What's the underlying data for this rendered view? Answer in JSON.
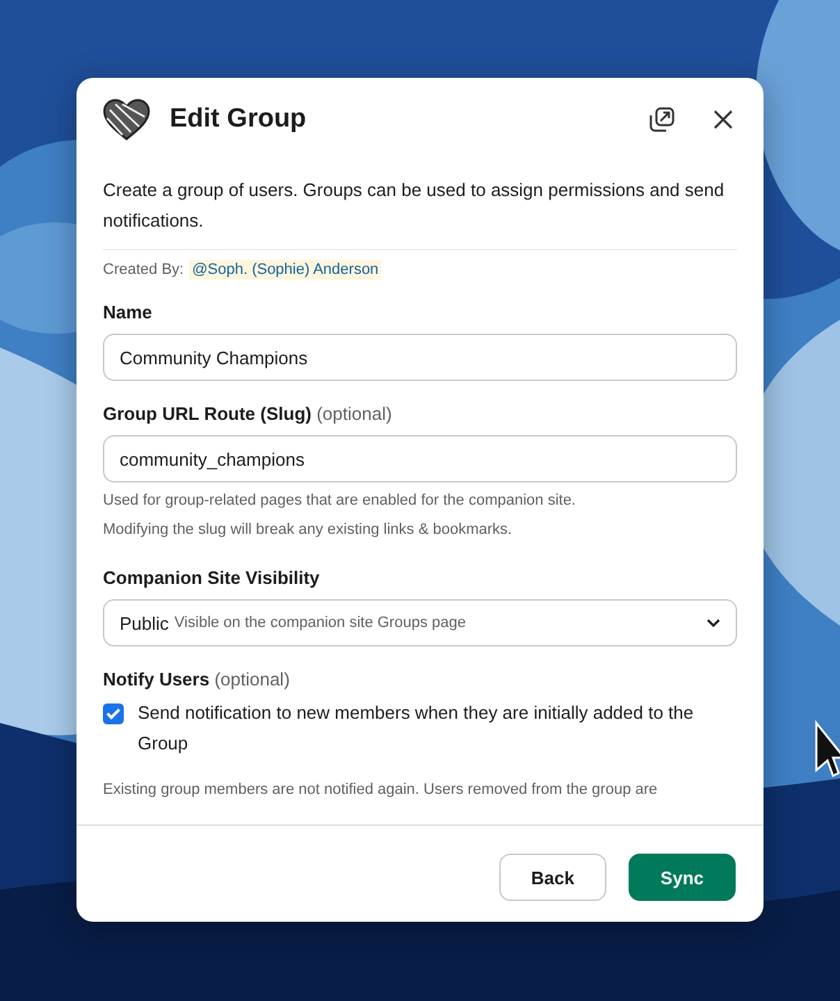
{
  "dialog": {
    "title": "Edit Group",
    "description": "Create a group of users. Groups can be used to assign permissions and send notifications.",
    "created_by": {
      "label": "Created By:",
      "user": "@Soph. (Sophie) Anderson"
    },
    "fields": [
      {
        "kind": "text",
        "label": "Name",
        "value": "Community Champions"
      },
      {
        "kind": "text",
        "label": "Group URL Route (Slug)",
        "note": "(optional)",
        "value": "community_champions",
        "help": [
          "Used for group-related pages that are enabled for the companion site.",
          "Modifying the slug will break any existing links & bookmarks."
        ]
      },
      {
        "kind": "select",
        "label": "Companion Site Visibility",
        "value": "Public",
        "detail": "Visible on the companion site Groups page"
      },
      {
        "kind": "checkbox",
        "label": "Notify Users",
        "note": "(optional)",
        "option": "Send notification to new members when they are initially added to the Group",
        "checked": true,
        "help": [
          "Existing group members are not notified again. Users removed from the group are"
        ]
      }
    ],
    "buttons": [
      {
        "label": "Back",
        "kind": "secondary"
      },
      {
        "label": "Sync",
        "kind": "primary"
      }
    ]
  }
}
